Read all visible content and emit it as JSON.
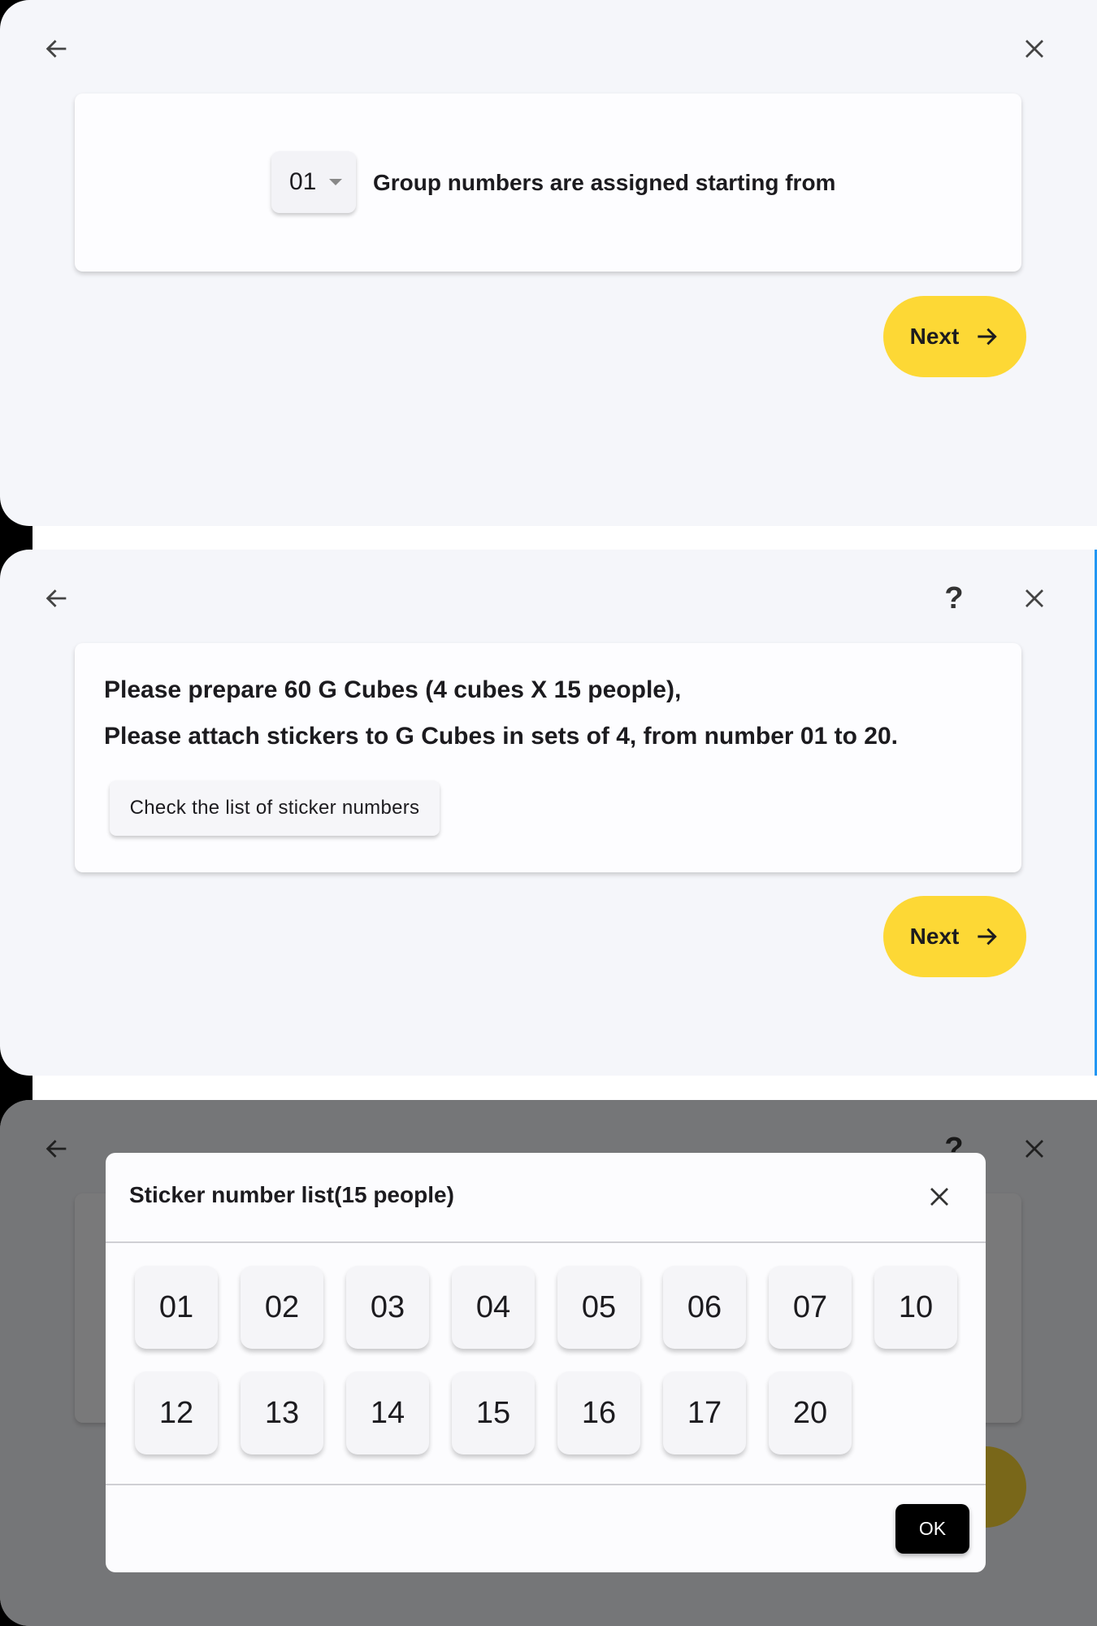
{
  "colors": {
    "accent": "#fdd835",
    "panel_bg": "#f5f6fa",
    "ok_button": "#000000"
  },
  "step1": {
    "start_number": "01",
    "label": "Group numbers are assigned starting from",
    "next_label": "Next"
  },
  "step2": {
    "line1": "Please prepare 60 G Cubes (4 cubes X 15 people),",
    "line2": "Please attach stickers to G Cubes in sets of 4, from number 01 to 20.",
    "check_button": "Check the list of sticker numbers",
    "help_label": "?",
    "next_label": "Next"
  },
  "dialog": {
    "title": "Sticker number list(15 people)",
    "numbers": [
      "01",
      "02",
      "03",
      "04",
      "05",
      "06",
      "07",
      "10",
      "12",
      "13",
      "14",
      "15",
      "16",
      "17",
      "20"
    ],
    "ok_label": "OK"
  }
}
